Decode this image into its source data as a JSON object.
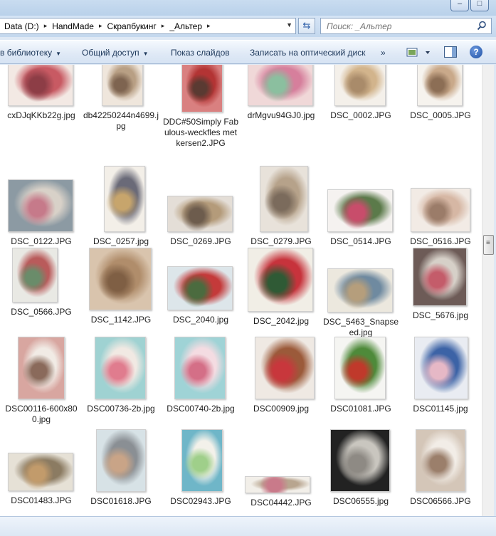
{
  "window": {
    "minimize": "–",
    "maximize": "□"
  },
  "address": {
    "crumbs": [
      "Data (D:)",
      "HandMade",
      "Скрапбукинг",
      "_Альтер"
    ],
    "separator": "▸"
  },
  "search": {
    "placeholder": "Поиск: _Альтер"
  },
  "toolbar": {
    "library": "в библиотеку",
    "share": "Общий доступ",
    "slideshow": "Показ слайдов",
    "burn": "Записать на оптический диск",
    "more": "»",
    "help": "?"
  },
  "files": [
    {
      "name": "cxDJqKKb22g.jpg",
      "colors": [
        "#f3e9e4",
        "#c85a63",
        "#8d3d46"
      ]
    },
    {
      "name": "db42250244n4699.jpg",
      "colors": [
        "#efe6dc",
        "#b89f84",
        "#7e6450"
      ]
    },
    {
      "name": "DDC#50Simply Fabulous-weckfles met kersen2.JPG",
      "colors": [
        "#d98080",
        "#b33434",
        "#5a3a32"
      ]
    },
    {
      "name": "drMgvu94GJ0.jpg",
      "colors": [
        "#f0d8d8",
        "#d67f9c",
        "#8bbf9f"
      ]
    },
    {
      "name": "DSC_0002.JPG",
      "colors": [
        "#f4f0ea",
        "#d2b48c",
        "#a98b6a"
      ]
    },
    {
      "name": "DSC_0005.JPG",
      "colors": [
        "#f6f3ee",
        "#c9a98a",
        "#8c6e55"
      ]
    },
    {
      "name": "DSC_0122.JPG",
      "colors": [
        "#8c9aa3",
        "#d8d1c8",
        "#c67a8a"
      ]
    },
    {
      "name": "DSC_0257.jpg",
      "colors": [
        "#f3efe8",
        "#6a6a78",
        "#c7a56c"
      ]
    },
    {
      "name": "DSC_0269.JPG",
      "colors": [
        "#e4ded7",
        "#b49b7a",
        "#6d5c4d"
      ]
    },
    {
      "name": "DSC_0279.JPG",
      "colors": [
        "#e8e2da",
        "#b6a28a",
        "#7b6b5c"
      ]
    },
    {
      "name": "DSC_0514.JPG",
      "colors": [
        "#f5f2f0",
        "#5b7a4a",
        "#c84d6b"
      ]
    },
    {
      "name": "DSC_0516.JPG",
      "colors": [
        "#f2ebe5",
        "#d6b7a4",
        "#9b7c69"
      ]
    },
    {
      "name": "DSC_0566.JPG",
      "colors": [
        "#e9e9e4",
        "#b95b5b",
        "#6a8c6a"
      ]
    },
    {
      "name": "DSC_1142.JPG",
      "colors": [
        "#d9c4ad",
        "#b08d6b",
        "#7f5f44"
      ]
    },
    {
      "name": "DSC_2040.jpg",
      "colors": [
        "#dde6ea",
        "#c43a3a",
        "#4b6b3f"
      ]
    },
    {
      "name": "DSC_2042.jpg",
      "colors": [
        "#f1eee6",
        "#c7333c",
        "#2f5a35"
      ]
    },
    {
      "name": "DSC_5463_Snapseed.jpg",
      "colors": [
        "#ece8de",
        "#6f8aa0",
        "#b59e7c"
      ]
    },
    {
      "name": "DSC_5676.jpg",
      "colors": [
        "#6d5b57",
        "#d6d0c8",
        "#c45c6a"
      ]
    },
    {
      "name": "DSC00116-600x800.jpg",
      "colors": [
        "#d8a6a0",
        "#f1ebe5",
        "#8a6a5b"
      ]
    },
    {
      "name": "DSC00736-2b.jpg",
      "colors": [
        "#9fd2d2",
        "#f1e9e3",
        "#e07c8e"
      ]
    },
    {
      "name": "DSC00740-2b.jpg",
      "colors": [
        "#9fd3d6",
        "#f4dce2",
        "#d46f87"
      ]
    },
    {
      "name": "DSC00909.jpg",
      "colors": [
        "#efe9e3",
        "#9b5a3a",
        "#c8373c"
      ]
    },
    {
      "name": "DSC01081.JPG",
      "colors": [
        "#f5f5f2",
        "#4e8a3a",
        "#c0392b"
      ]
    },
    {
      "name": "DSC01145.jpg",
      "colors": [
        "#e9ecf2",
        "#3c63a6",
        "#e6b8c6"
      ]
    },
    {
      "name": "DSC01483.JPG",
      "colors": [
        "#e6e1d6",
        "#8b7b62",
        "#c29b6b"
      ]
    },
    {
      "name": "DSC01618.JPG",
      "colors": [
        "#d7e2e6",
        "#8a8f94",
        "#c9a487"
      ]
    },
    {
      "name": "DSC02943.JPG",
      "colors": [
        "#6fb6c8",
        "#f3f1ea",
        "#9fcf8a"
      ]
    },
    {
      "name": "DSC04442.JPG",
      "colors": [
        "#f2efe9",
        "#b8a58f",
        "#c97a8a"
      ]
    },
    {
      "name": "DSC06555.jpg",
      "colors": [
        "#222222",
        "#c9c6bf",
        "#8e8a84"
      ]
    },
    {
      "name": "DSC06566.JPG",
      "colors": [
        "#d4c6b8",
        "#f2ede7",
        "#9b7f6b"
      ]
    }
  ]
}
